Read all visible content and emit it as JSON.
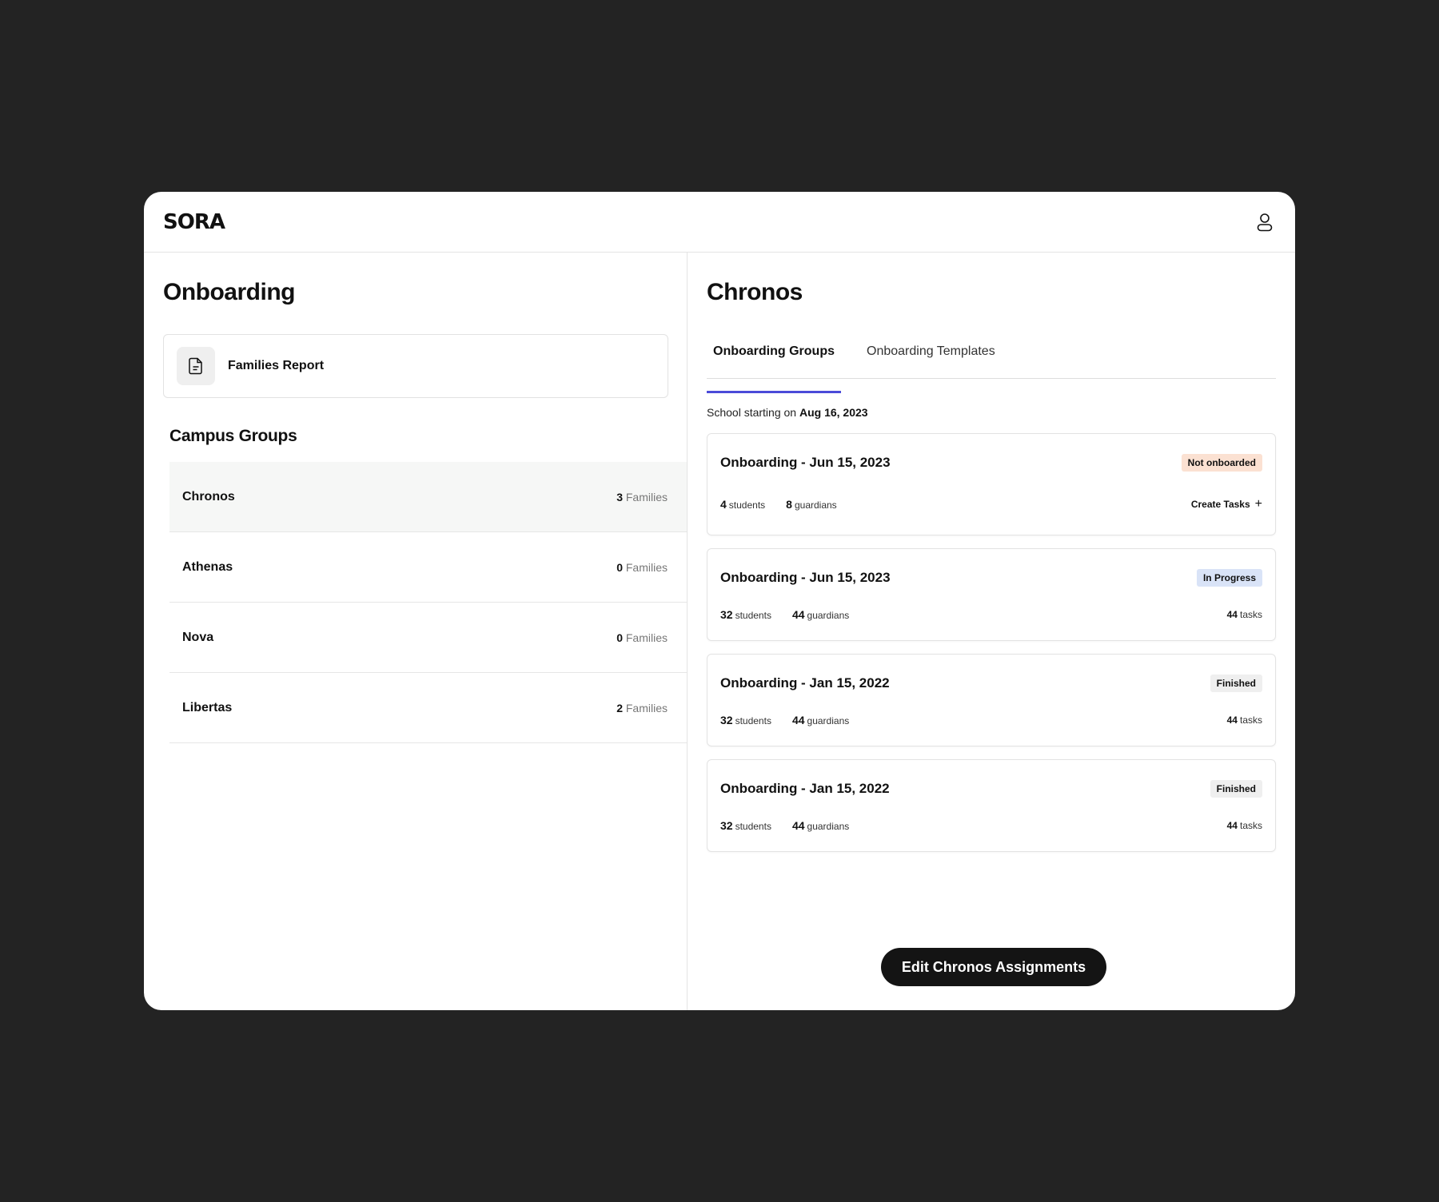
{
  "app": {
    "logo": "SORA"
  },
  "left": {
    "title": "Onboarding",
    "report": {
      "label": "Families Report"
    },
    "campus_groups_title": "Campus Groups",
    "groups": [
      {
        "name": "Chronos",
        "count": "3",
        "unit": "Families",
        "active": true
      },
      {
        "name": "Athenas",
        "count": "0",
        "unit": "Families"
      },
      {
        "name": "Nova",
        "count": "0",
        "unit": "Families"
      },
      {
        "name": "Libertas",
        "count": "2",
        "unit": "Families"
      }
    ]
  },
  "right": {
    "title": "Chronos",
    "tabs": [
      {
        "label": "Onboarding Groups",
        "active": true
      },
      {
        "label": "Onboarding Templates"
      }
    ],
    "school_start_prefix": "School starting on",
    "school_start_date": "Aug 16, 2023",
    "cards": [
      {
        "title": "Onboarding - Jun 15, 2023",
        "status": "Not onboarded",
        "status_bg": "#fbe1d2",
        "students": "4",
        "students_label": "students",
        "guardians": "8",
        "guardians_label": "guardians",
        "action": "Create Tasks"
      },
      {
        "title": "Onboarding - Jun 15, 2023",
        "status": "In Progress",
        "status_bg": "#d9e3f7",
        "students": "32",
        "students_label": "students",
        "guardians": "44",
        "guardians_label": "guardians",
        "tasks": "44",
        "tasks_label": "tasks"
      },
      {
        "title": "Onboarding - Jan 15, 2022",
        "status": "Finished",
        "status_bg": "#efefef",
        "students": "32",
        "students_label": "students",
        "guardians": "44",
        "guardians_label": "guardians",
        "tasks": "44",
        "tasks_label": "tasks"
      },
      {
        "title": "Onboarding - Jan 15, 2022",
        "status": "Finished",
        "status_bg": "#efefef",
        "students": "32",
        "students_label": "students",
        "guardians": "44",
        "guardians_label": "guardians",
        "tasks": "44",
        "tasks_label": "tasks"
      }
    ],
    "edit_button": "Edit Chronos Assignments"
  }
}
